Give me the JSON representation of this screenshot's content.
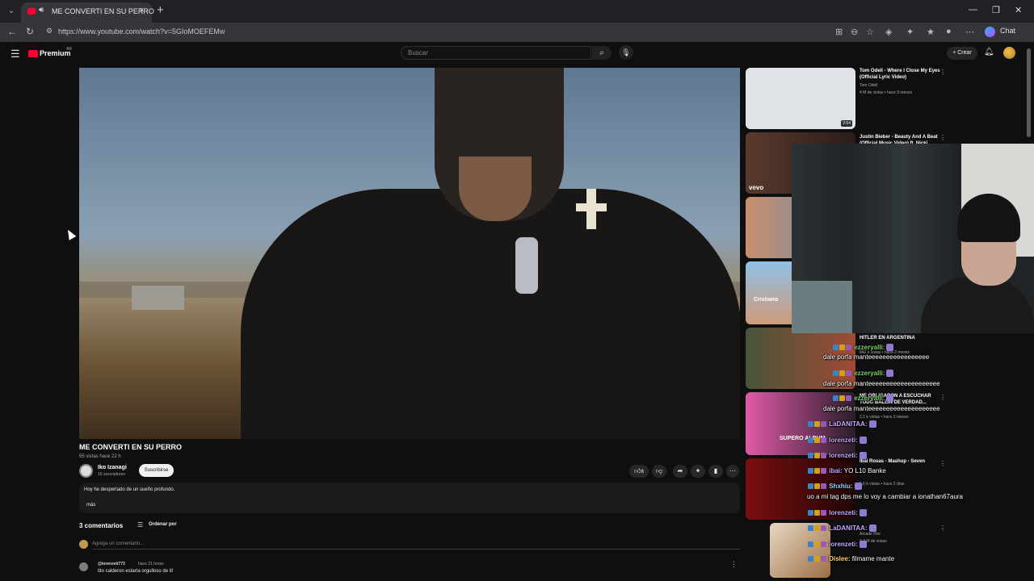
{
  "browser": {
    "tab_title": "ME CONVERTI EN SU PERRO",
    "tab_close": "×",
    "new_tab": "+",
    "url": "https://www.youtube.com/watch?v=5GIoMOEFEMw",
    "chat_label": "Chat",
    "window_controls": [
      "—",
      "❐",
      "✕"
    ]
  },
  "youtube": {
    "logo_label": "Premium",
    "country": "AR",
    "search_placeholder": "Buscar",
    "create_label": "+ Crear"
  },
  "video": {
    "title": "ME CONVERTI EN SU PERRO",
    "views": "55 vistas  hace 22 h",
    "channel_name": "Iko Izanagi",
    "channel_subs": "16 suscriptores",
    "subscribe_label": "Suscribirse",
    "like_count": "8",
    "description": "Hoy he despertado de un sueño profundo.",
    "more_label": "más"
  },
  "comments": {
    "count_label": "3 comentarios",
    "sort_label": "Ordenar por",
    "add_placeholder": "Agrega un comentario...",
    "first": {
      "user": "@lorenzeti773",
      "time": "hace 21 horas",
      "text": "tito calderon estaría orgulloso de ti!"
    }
  },
  "sidebar": {
    "items": [
      {
        "title": "Tom Odell - Where I Close My Eyes (Official Lyric Video)",
        "channel": "Tom Odell",
        "meta": "4 M de vistas • hace 9 meses",
        "duration": "2:54"
      },
      {
        "title": "Justin Bieber - Beauty And A Beat (Official Music Video) ft. Nicki ...",
        "badge": "vevo"
      },
      {
        "title": "HITLER EN ARGENTINA",
        "meta": "842 k vistas • hace 2 meses"
      },
      {
        "title": "ME OBLIGARON A ESCUCHAR TODO BALLIN DE VERDAD...",
        "meta": "2,1 k vistas • hace 3 meses"
      },
      {
        "title": "Ibai Rosas - Mashup - Seven",
        "meta": "1,6 k vistas • hace 2 días"
      },
      {
        "title": "",
        "channel": "Arcade Fire",
        "meta": "4,4 M de vistas"
      }
    ],
    "thumb_captions": [
      "Cristiano",
      "SUPERO ALBUM"
    ]
  },
  "stream_chat": [
    {
      "user": "ezzeryalli:",
      "color": "#7bd46a",
      "text": ""
    },
    {
      "user": "",
      "color": "#ffffff",
      "text": "dale porfa manteeeeeeeeeeeeeeeee"
    },
    {
      "user": "ezzeryalli:",
      "color": "#7bd46a",
      "text": ""
    },
    {
      "user": "",
      "color": "#ffffff",
      "text": "dale porfa manteeeeeeeeeeeeeeeeeeee"
    },
    {
      "user": "ezzeryalli:",
      "color": "#7bd46a",
      "text": ""
    },
    {
      "user": "",
      "color": "#ffffff",
      "text": "dale porfa manteeeeeeeeeeeeeeeeeeee"
    },
    {
      "user": "LaDANITAA:",
      "color": "#c4a8ff",
      "text": ""
    },
    {
      "user": "lorenzeti:",
      "color": "#c4a8ff",
      "text": ""
    },
    {
      "user": "lorenzeti:",
      "color": "#c4a8ff",
      "text": ""
    },
    {
      "user": "ibai:",
      "color": "#c4a8ff",
      "text": " YO L10 Banke"
    },
    {
      "user": "Shxhiu:",
      "color": "#9ad0ff",
      "text": ""
    },
    {
      "user": "",
      "color": "#ffffff",
      "text": "uo a mi tag dps me lo voy a cambiar a ionathan67aura"
    },
    {
      "user": "lorenzeti:",
      "color": "#c4a8ff",
      "text": ""
    },
    {
      "user": "LaDANITAA:",
      "color": "#c4a8ff",
      "text": ""
    },
    {
      "user": "lorenzeti:",
      "color": "#c4a8ff",
      "text": ""
    },
    {
      "user": "Dislee:",
      "color": "#ffcf6b",
      "text": " filmame mante"
    }
  ],
  "colors": {
    "background": "#0f0f0f",
    "brand_red": "#ff0033"
  }
}
